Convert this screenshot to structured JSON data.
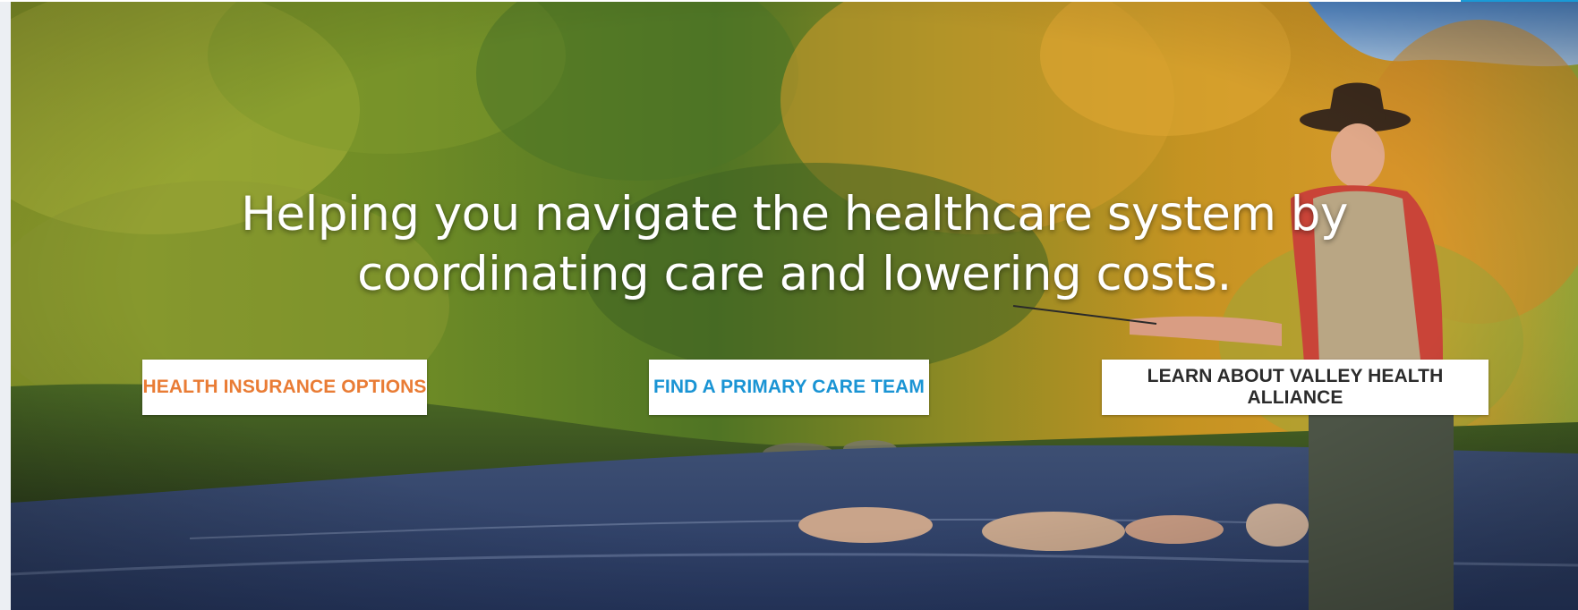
{
  "hero": {
    "headline_line1": "Helping you navigate the healthcare system by",
    "headline_line2": "coordinating care and lowering costs."
  },
  "actions": {
    "health_insurance_label": "HEALTH INSURANCE OPTIONS",
    "primary_care_label": "FIND A PRIMARY CARE TEAM",
    "learn_label": "LEARN ABOUT VALLEY HEALTH ALLIANCE"
  },
  "colors": {
    "insurance_text": "#e97c35",
    "primary_care_text": "#1a94d4",
    "learn_text": "#2b2b2b",
    "top_accent": "#1a9ad6"
  }
}
